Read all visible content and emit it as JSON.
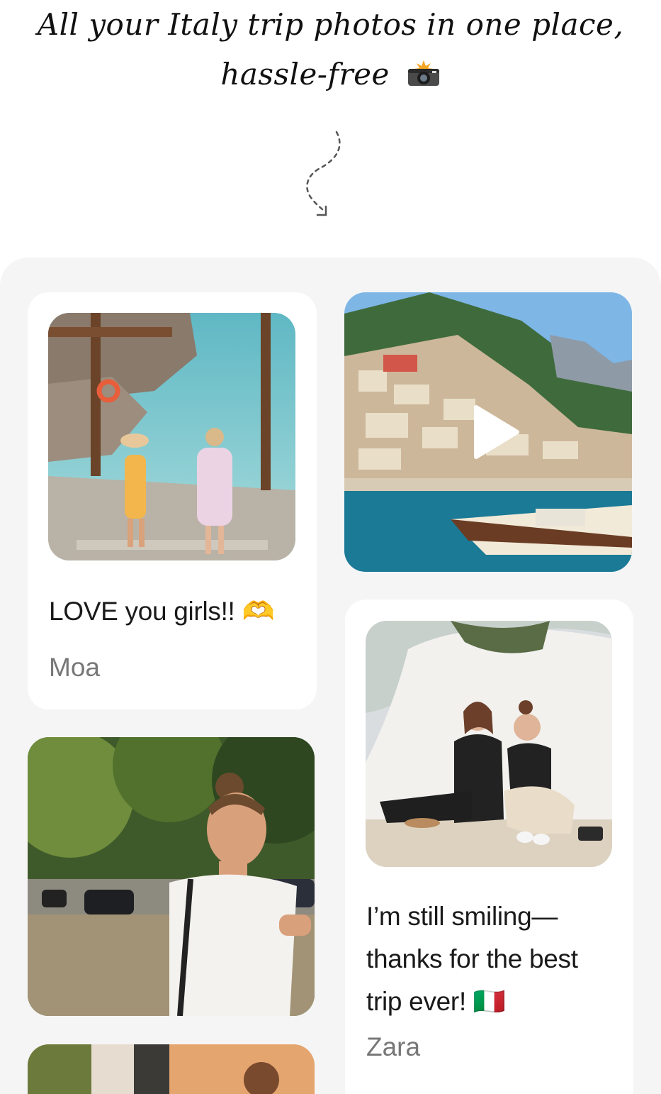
{
  "header": {
    "line1": "All your Italy trip photos in one place,",
    "line2": "hassle-free",
    "emoji_icon": "camera-flash-icon"
  },
  "posts": [
    {
      "caption": "LOVE you girls!! 🫶",
      "author": "Moa",
      "media": "beach-stairs-photo"
    },
    {
      "media": "positano-video",
      "has_play": true
    },
    {
      "media": "woman-smiling-photo"
    },
    {
      "caption_lines": [
        "I’m still smiling—",
        "thanks for the best",
        "trip ever! 🇮🇹"
      ],
      "author": "Zara",
      "media": "two-women-wall-photo"
    },
    {
      "media": "cafe-photo-partial"
    }
  ],
  "colors": {
    "panel_bg": "#f5f5f5",
    "card_bg": "#ffffff",
    "author_text": "#777777"
  }
}
